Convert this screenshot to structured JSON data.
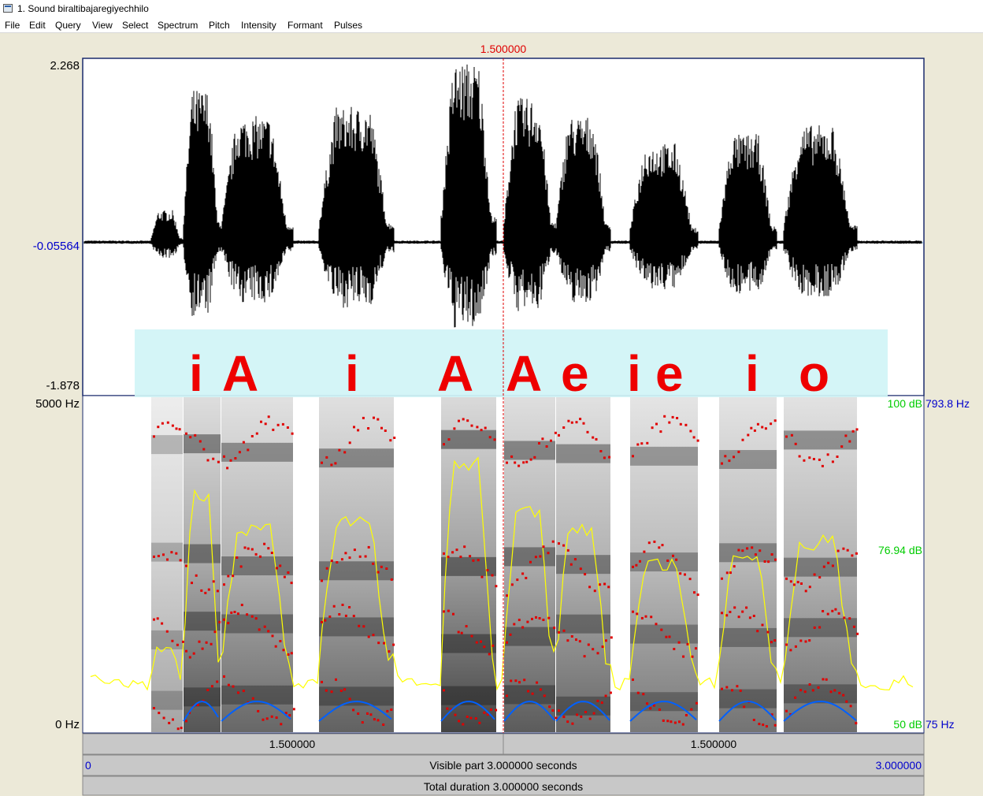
{
  "window": {
    "title": "1. Sound biraltibajaregiyechhilo"
  },
  "menu": [
    "File",
    "Edit",
    "Query",
    "View",
    "Select",
    "Spectrum",
    "Pitch",
    "Intensity",
    "Formant",
    "Pulses"
  ],
  "cursor_time": "1.500000",
  "waveform": {
    "max": "2.268",
    "zero": "-0.05564",
    "min": "-1.878"
  },
  "spectrogram": {
    "freq_top": "5000 Hz",
    "freq_bottom": "0 Hz",
    "intensity_top": "100 dB",
    "intensity_mid": "76.94 dB",
    "intensity_bottom": "50 dB",
    "pitch_top": "793.8 Hz",
    "pitch_bottom": "75 Hz"
  },
  "vowel_annotation": [
    "i",
    "A",
    "i",
    "A",
    "A",
    "e",
    "i",
    "e",
    "i",
    "o"
  ],
  "bottom_bar": {
    "left_segment_time": "1.500000",
    "right_segment_time": "1.500000",
    "visible_start": "0",
    "visible_label": "Visible part 3.000000 seconds",
    "visible_end": "3.000000",
    "total_label": "Total duration 3.000000 seconds"
  },
  "colors": {
    "cursor": "#e00000",
    "intensity_label": "#00cc00",
    "pitch_label": "#0000cc",
    "formant": "#e00000",
    "pitch": "#0060ff",
    "intensity": "#ffff00",
    "annotation_band": "#d0f4f6",
    "annotation_text": "#ee0000"
  }
}
